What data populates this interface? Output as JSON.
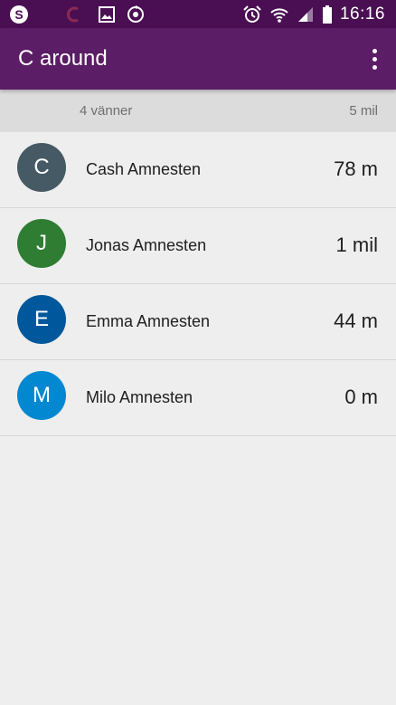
{
  "status_bar": {
    "time": "16:16",
    "icons": [
      "skype-icon",
      "c-around-icon",
      "image-icon",
      "sync-icon",
      "alarm-icon",
      "wifi-icon",
      "signal-icon",
      "battery-icon"
    ]
  },
  "app_bar": {
    "title": "C around"
  },
  "summary": {
    "friends_count": "4 vänner",
    "range": "5 mil"
  },
  "friends": [
    {
      "initial": "C",
      "name": "Cash Amnesten",
      "distance": "78 m",
      "color": "#455a64"
    },
    {
      "initial": "J",
      "name": "Jonas Amnesten",
      "distance": "1 mil",
      "color": "#2e7d32"
    },
    {
      "initial": "E",
      "name": "Emma Amnesten",
      "distance": "44 m",
      "color": "#01579b"
    },
    {
      "initial": "M",
      "name": "Milo Amnesten",
      "distance": "0 m",
      "color": "#0288d1"
    }
  ],
  "colors": {
    "status_bar": "#4a0f53",
    "app_bar": "#5b1d65",
    "background": "#eeeeee"
  }
}
